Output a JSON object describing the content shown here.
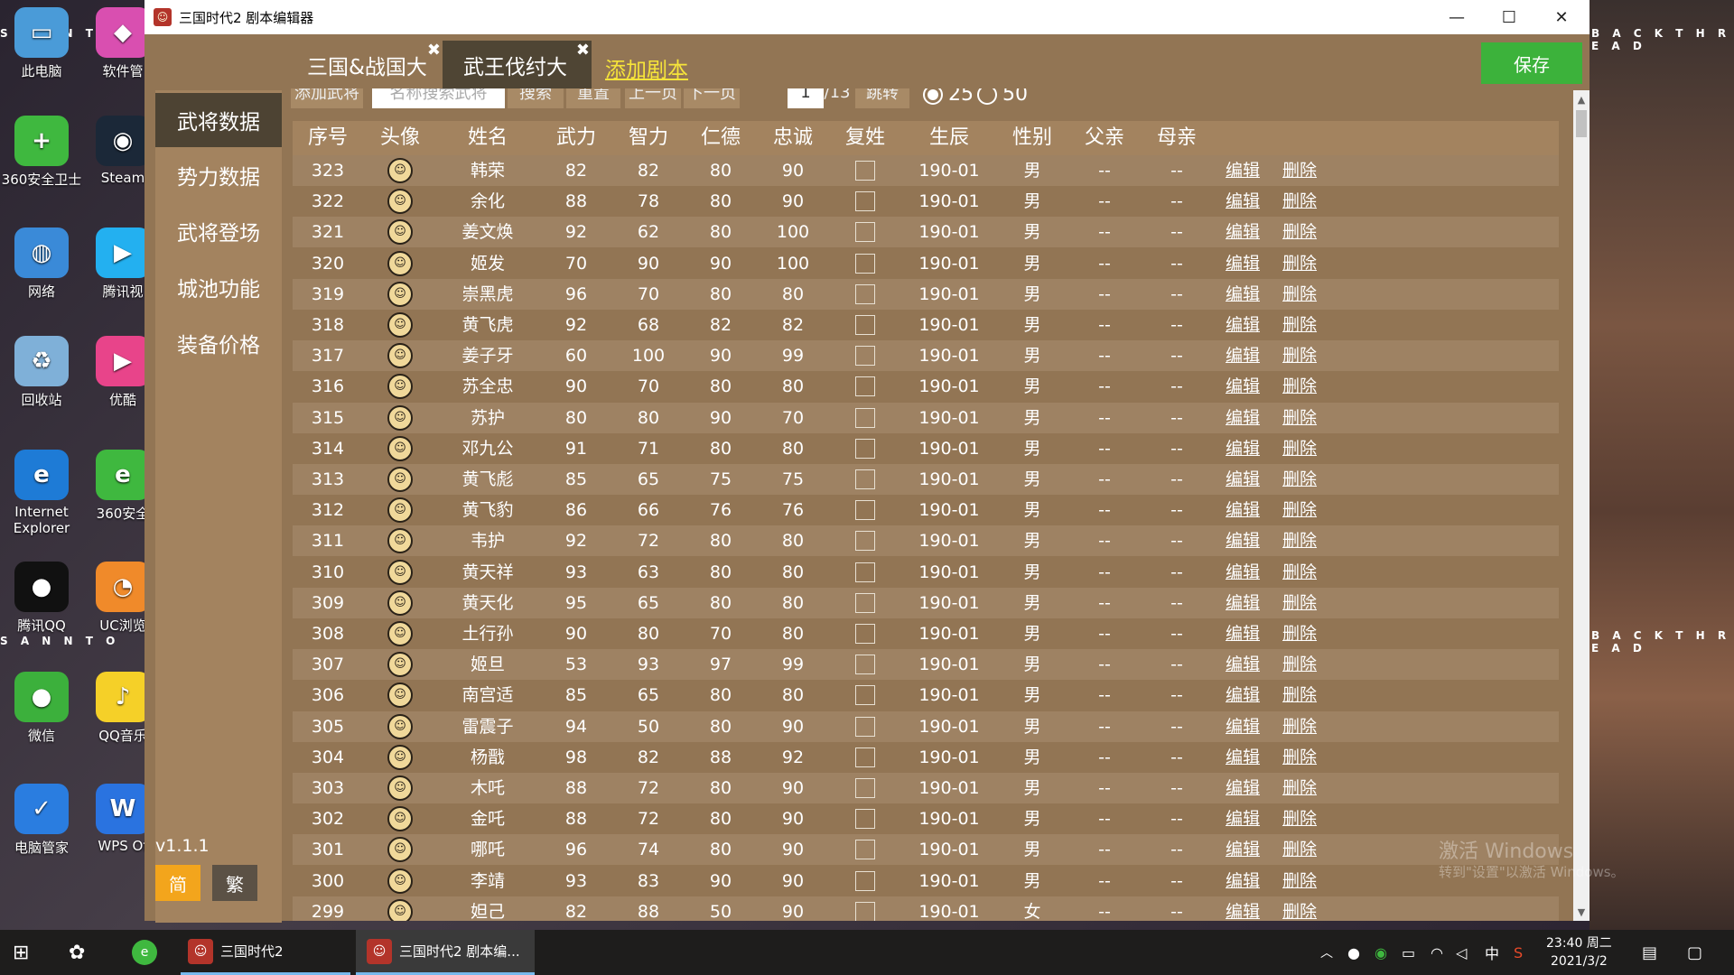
{
  "desktop": {
    "deco_text_top": "S A N    N T O",
    "deco_text_right": "B A C K   T H R E A D",
    "icons": [
      {
        "label": "此电脑",
        "glyph": "▭",
        "color": "#4a9bd8"
      },
      {
        "label": "软件管",
        "glyph": "◆",
        "color": "#d94fb0"
      },
      {
        "label": "360安全卫士",
        "glyph": "+",
        "color": "#3fb83f"
      },
      {
        "label": "Steam",
        "glyph": "◉",
        "color": "#1b2838"
      },
      {
        "label": "网络",
        "glyph": "◍",
        "color": "#3a8ad8"
      },
      {
        "label": "腾讯视",
        "glyph": "▶",
        "color": "#23b0f0"
      },
      {
        "label": "回收站",
        "glyph": "♻",
        "color": "#7fb0d8"
      },
      {
        "label": "优酷",
        "glyph": "▶",
        "color": "#e8448a"
      },
      {
        "label": "Internet Explorer",
        "glyph": "e",
        "color": "#1e7bd6"
      },
      {
        "label": "360安全",
        "glyph": "e",
        "color": "#3fb83f"
      },
      {
        "label": "腾讯QQ",
        "glyph": "●",
        "color": "#111111"
      },
      {
        "label": "UC浏览",
        "glyph": "◔",
        "color": "#f08a2a"
      },
      {
        "label": "微信",
        "glyph": "●",
        "color": "#3cb03c"
      },
      {
        "label": "QQ音乐",
        "glyph": "♪",
        "color": "#f5d028"
      },
      {
        "label": "电脑管家",
        "glyph": "✓",
        "color": "#2a7de0"
      },
      {
        "label": "WPS Of",
        "glyph": "W",
        "color": "#2a73e0"
      }
    ]
  },
  "window": {
    "title": "三国时代2 剧本编辑器",
    "minimize": "—",
    "maximize": "☐",
    "close": "✕"
  },
  "tabs": [
    {
      "label": "三国&战国大",
      "close": "✖"
    },
    {
      "label": "武王伐纣大",
      "close": "✖"
    }
  ],
  "add_tab": "添加剧本",
  "save_label": "保存",
  "sidebar": {
    "items": [
      "武将数据",
      "势力数据",
      "武将登场",
      "城池功能",
      "装备价格"
    ],
    "version": "v1.1.1",
    "lang_simplified": "简",
    "lang_traditional": "繁"
  },
  "toolbar": {
    "add": "添加武将",
    "search_placeholder": "名称搜索武将",
    "search": "搜索",
    "reset": "重置",
    "prev": "上一页",
    "next": "下一页",
    "page": "1",
    "total": "/13",
    "jump": "跳转",
    "size25": "25",
    "size50": "50"
  },
  "table": {
    "headers": [
      "序号",
      "头像",
      "姓名",
      "武力",
      "智力",
      "仁德",
      "忠诚",
      "复姓",
      "生辰",
      "性别",
      "父亲",
      "母亲"
    ],
    "edit_label": "编辑",
    "delete_label": "删除",
    "rows": [
      {
        "id": "323",
        "avatar": "☺",
        "name": "韩荣",
        "wu": "82",
        "zhi": "82",
        "ren": "80",
        "zhong": "90",
        "birth": "190-01",
        "sex": "男",
        "father": "--",
        "mother": "--"
      },
      {
        "id": "322",
        "avatar": "☺",
        "name": "余化",
        "wu": "88",
        "zhi": "78",
        "ren": "80",
        "zhong": "90",
        "birth": "190-01",
        "sex": "男",
        "father": "--",
        "mother": "--"
      },
      {
        "id": "321",
        "avatar": "☺",
        "name": "姜文焕",
        "wu": "92",
        "zhi": "62",
        "ren": "80",
        "zhong": "100",
        "birth": "190-01",
        "sex": "男",
        "father": "--",
        "mother": "--"
      },
      {
        "id": "320",
        "avatar": "☺",
        "name": "姬发",
        "wu": "70",
        "zhi": "90",
        "ren": "90",
        "zhong": "100",
        "birth": "190-01",
        "sex": "男",
        "father": "--",
        "mother": "--"
      },
      {
        "id": "319",
        "avatar": "☺",
        "name": "崇黑虎",
        "wu": "96",
        "zhi": "70",
        "ren": "80",
        "zhong": "80",
        "birth": "190-01",
        "sex": "男",
        "father": "--",
        "mother": "--"
      },
      {
        "id": "318",
        "avatar": "☺",
        "name": "黄飞虎",
        "wu": "92",
        "zhi": "68",
        "ren": "82",
        "zhong": "82",
        "birth": "190-01",
        "sex": "男",
        "father": "--",
        "mother": "--"
      },
      {
        "id": "317",
        "avatar": "☺",
        "name": "姜子牙",
        "wu": "60",
        "zhi": "100",
        "ren": "90",
        "zhong": "99",
        "birth": "190-01",
        "sex": "男",
        "father": "--",
        "mother": "--"
      },
      {
        "id": "316",
        "avatar": "☺",
        "name": "苏全忠",
        "wu": "90",
        "zhi": "70",
        "ren": "80",
        "zhong": "80",
        "birth": "190-01",
        "sex": "男",
        "father": "--",
        "mother": "--"
      },
      {
        "id": "315",
        "avatar": "☺",
        "name": "苏护",
        "wu": "80",
        "zhi": "80",
        "ren": "90",
        "zhong": "70",
        "birth": "190-01",
        "sex": "男",
        "father": "--",
        "mother": "--"
      },
      {
        "id": "314",
        "avatar": "☺",
        "name": "邓九公",
        "wu": "91",
        "zhi": "71",
        "ren": "80",
        "zhong": "80",
        "birth": "190-01",
        "sex": "男",
        "father": "--",
        "mother": "--"
      },
      {
        "id": "313",
        "avatar": "☺",
        "name": "黄飞彪",
        "wu": "85",
        "zhi": "65",
        "ren": "75",
        "zhong": "75",
        "birth": "190-01",
        "sex": "男",
        "father": "--",
        "mother": "--"
      },
      {
        "id": "312",
        "avatar": "☺",
        "name": "黄飞豹",
        "wu": "86",
        "zhi": "66",
        "ren": "76",
        "zhong": "76",
        "birth": "190-01",
        "sex": "男",
        "father": "--",
        "mother": "--"
      },
      {
        "id": "311",
        "avatar": "☺",
        "name": "韦护",
        "wu": "92",
        "zhi": "72",
        "ren": "80",
        "zhong": "80",
        "birth": "190-01",
        "sex": "男",
        "father": "--",
        "mother": "--"
      },
      {
        "id": "310",
        "avatar": "☺",
        "name": "黄天祥",
        "wu": "93",
        "zhi": "63",
        "ren": "80",
        "zhong": "80",
        "birth": "190-01",
        "sex": "男",
        "father": "--",
        "mother": "--"
      },
      {
        "id": "309",
        "avatar": "☺",
        "name": "黄天化",
        "wu": "95",
        "zhi": "65",
        "ren": "80",
        "zhong": "80",
        "birth": "190-01",
        "sex": "男",
        "father": "--",
        "mother": "--"
      },
      {
        "id": "308",
        "avatar": "☺",
        "name": "土行孙",
        "wu": "90",
        "zhi": "80",
        "ren": "70",
        "zhong": "80",
        "birth": "190-01",
        "sex": "男",
        "father": "--",
        "mother": "--"
      },
      {
        "id": "307",
        "avatar": "☺",
        "name": "姬旦",
        "wu": "53",
        "zhi": "93",
        "ren": "97",
        "zhong": "99",
        "birth": "190-01",
        "sex": "男",
        "father": "--",
        "mother": "--"
      },
      {
        "id": "306",
        "avatar": "☺",
        "name": "南宫适",
        "wu": "85",
        "zhi": "65",
        "ren": "80",
        "zhong": "80",
        "birth": "190-01",
        "sex": "男",
        "father": "--",
        "mother": "--"
      },
      {
        "id": "305",
        "avatar": "☺",
        "name": "雷震子",
        "wu": "94",
        "zhi": "50",
        "ren": "80",
        "zhong": "90",
        "birth": "190-01",
        "sex": "男",
        "father": "--",
        "mother": "--"
      },
      {
        "id": "304",
        "avatar": "☺",
        "name": "杨戬",
        "wu": "98",
        "zhi": "82",
        "ren": "88",
        "zhong": "92",
        "birth": "190-01",
        "sex": "男",
        "father": "--",
        "mother": "--"
      },
      {
        "id": "303",
        "avatar": "☺",
        "name": "木吒",
        "wu": "88",
        "zhi": "72",
        "ren": "80",
        "zhong": "90",
        "birth": "190-01",
        "sex": "男",
        "father": "--",
        "mother": "--"
      },
      {
        "id": "302",
        "avatar": "☺",
        "name": "金吒",
        "wu": "88",
        "zhi": "72",
        "ren": "80",
        "zhong": "90",
        "birth": "190-01",
        "sex": "男",
        "father": "--",
        "mother": "--"
      },
      {
        "id": "301",
        "avatar": "☺",
        "name": "哪吒",
        "wu": "96",
        "zhi": "74",
        "ren": "80",
        "zhong": "90",
        "birth": "190-01",
        "sex": "男",
        "father": "--",
        "mother": "--"
      },
      {
        "id": "300",
        "avatar": "☺",
        "name": "李靖",
        "wu": "93",
        "zhi": "83",
        "ren": "90",
        "zhong": "90",
        "birth": "190-01",
        "sex": "男",
        "father": "--",
        "mother": "--"
      },
      {
        "id": "299",
        "avatar": "☺",
        "name": "妲己",
        "wu": "82",
        "zhi": "88",
        "ren": "50",
        "zhong": "90",
        "birth": "190-01",
        "sex": "女",
        "father": "--",
        "mother": "--"
      }
    ]
  },
  "watermark": {
    "line1": "激活 Windows",
    "line2": "转到\"设置\"以激活 Windows。"
  },
  "taskbar": {
    "apps": [
      {
        "label": "三国时代2",
        "glyph": "☺"
      },
      {
        "label": "三国时代2 剧本编...",
        "glyph": "☺"
      }
    ],
    "tray_ime": "中",
    "time": "23:40 周二",
    "date": "2021/3/2"
  },
  "colors": {
    "app_bg": "#927554",
    "sidebar_bg": "#a3835f",
    "active_bg": "#4d4333",
    "save_green": "#3cb23b",
    "add_tab_yellow": "#f6e43a",
    "lang_active": "#f3a51c"
  }
}
